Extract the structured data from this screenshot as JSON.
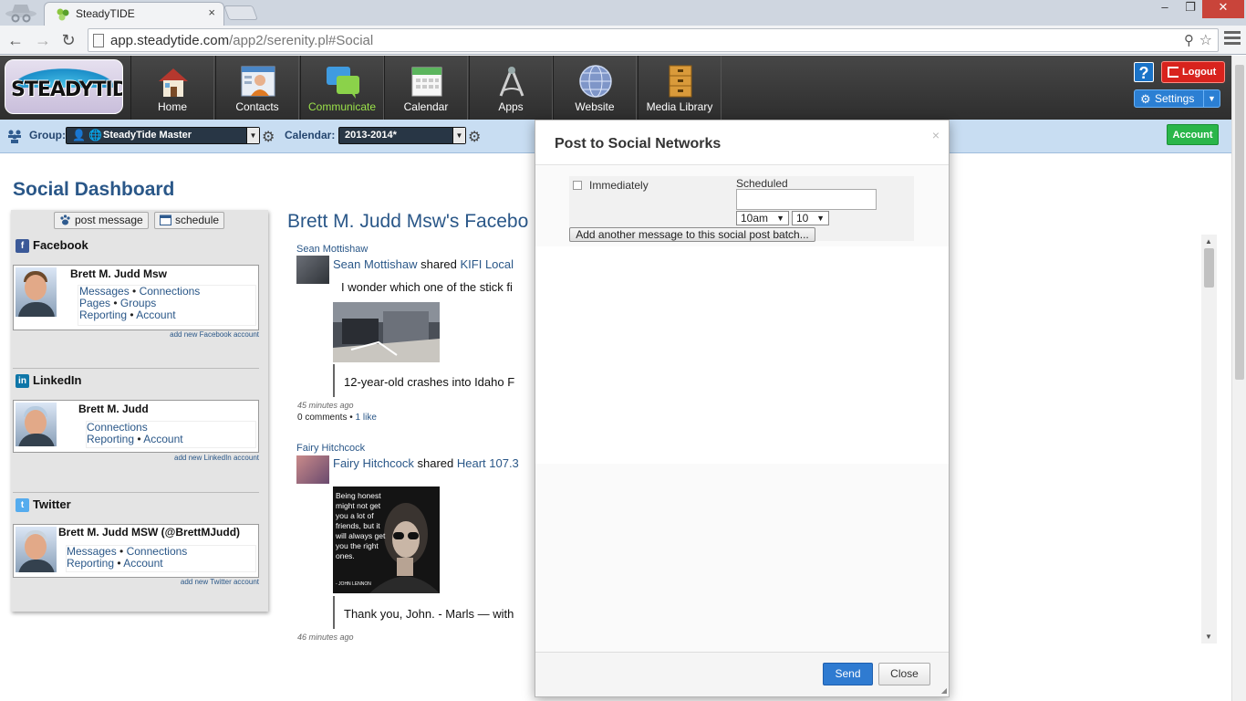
{
  "browser": {
    "tab_title": "SteadyTIDE",
    "tab_close": "×",
    "url_host": "app.steadytide.com",
    "url_path": "/app2/serenity.pl#Social",
    "window_min": "‒",
    "window_max": "❐",
    "window_close": "✕"
  },
  "app": {
    "logo_text": "STEADYTIDE",
    "nav": [
      {
        "label": "Home",
        "icon": "home-icon"
      },
      {
        "label": "Contacts",
        "icon": "contacts-icon"
      },
      {
        "label": "Communicate",
        "icon": "communicate-icon",
        "active": true
      },
      {
        "label": "Calendar",
        "icon": "calendar-icon"
      },
      {
        "label": "Apps",
        "icon": "apps-icon"
      },
      {
        "label": "Website",
        "icon": "website-icon"
      },
      {
        "label": "Media Library",
        "icon": "media-library-icon"
      }
    ],
    "help_label": "?",
    "logout_label": "Logout",
    "settings_label": "Settings",
    "account_label": "Account",
    "accent_green": "#9be24a"
  },
  "groupbar": {
    "group_label": "Group:",
    "group_value": "SteadyTide Master",
    "calendar_label": "Calendar:",
    "calendar_value": "2013-2014*"
  },
  "page": {
    "title": "Social Dashboard",
    "post_message_label": "post message",
    "schedule_label": "schedule"
  },
  "networks": [
    {
      "name": "Facebook",
      "color": "#3b5998",
      "account": "Brett M. Judd Msw",
      "links_row1": [
        "Messages",
        "Connections"
      ],
      "links_row2": [
        "Pages",
        "Groups"
      ],
      "links_row3": [
        "Reporting",
        "Account"
      ],
      "add_new": "add new Facebook account"
    },
    {
      "name": "LinkedIn",
      "color": "#0e76a8",
      "account": "Brett M. Judd",
      "links_row1": [
        "Connections"
      ],
      "links_row2": [
        "Reporting",
        "Account"
      ],
      "add_new": "add new LinkedIn account"
    },
    {
      "name": "Twitter",
      "color": "#55acee",
      "account": "Brett M. Judd MSW (@BrettMJudd)",
      "links_row1": [
        "Messages",
        "Connections"
      ],
      "links_row2": [
        "Reporting",
        "Account"
      ],
      "add_new": "add new Twitter account"
    }
  ],
  "feed": {
    "title": "Brett M. Judd Msw's Facebo",
    "posts": [
      {
        "author": "Sean Mottishaw",
        "headline_name": "Sean Mottishaw",
        "headline_verb": "shared",
        "headline_target": "KIFI Local",
        "text": "I wonder which one of the stick fi",
        "quote": "12-year-old crashes into Idaho F",
        "time": "45 minutes ago",
        "comments": "0 comments",
        "likes": "1 like"
      },
      {
        "author": "Fairy Hitchcock",
        "headline_name": "Fairy Hitchcock",
        "headline_verb": "shared",
        "headline_target": "Heart 107.3",
        "image_caption": "Being honest might not get you a lot of friends, but it will always get you the right ones.",
        "image_signature": "- JOHN LENNON",
        "quote": "Thank you, John. - Marls — with",
        "time": "46 minutes ago"
      }
    ]
  },
  "modal": {
    "title": "Post to Social Networks",
    "close_x": "×",
    "immediately_label": "Immediately",
    "immediately_checked": false,
    "scheduled_label": "Scheduled",
    "scheduled_value": "",
    "hour_value": "10am",
    "minute_value": "10",
    "add_batch_label": "Add another message to this social post batch...",
    "send_label": "Send",
    "close_label": "Close"
  }
}
